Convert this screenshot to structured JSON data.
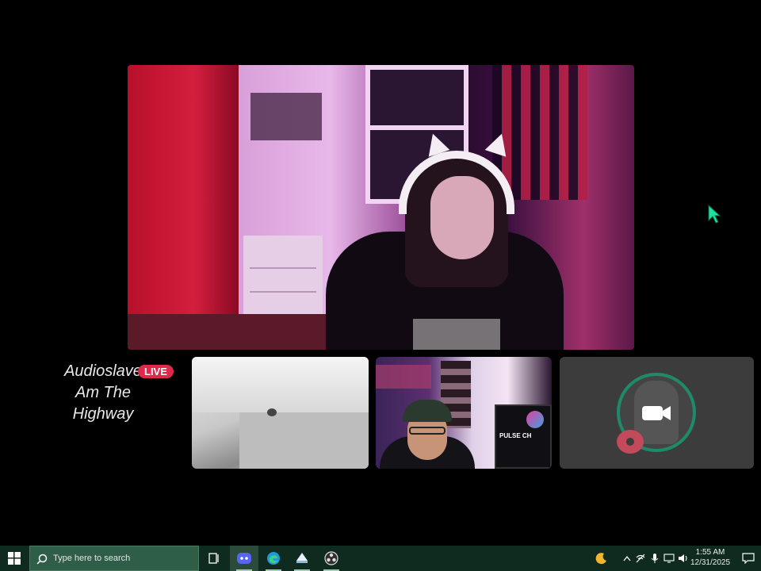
{
  "now_playing": {
    "artist": "Audioslave",
    "title_line1": "Am The",
    "title_line2": "Highway",
    "live_badge": "LIVE"
  },
  "participants": [
    {
      "id": "main-streamer",
      "role": "main camera"
    },
    {
      "id": "guest-1",
      "role": "camera tile"
    },
    {
      "id": "guest-2",
      "role": "camera tile",
      "monitor_text": "PULSE CH"
    },
    {
      "id": "guest-3",
      "role": "camera off tile",
      "icon": "video-camera-icon"
    }
  ],
  "taskbar": {
    "search_placeholder": "Type here to search",
    "apps": [
      {
        "name": "task-view",
        "icon": "task-view-icon"
      },
      {
        "name": "discord",
        "icon": "discord-icon",
        "active": true
      },
      {
        "name": "edge",
        "icon": "edge-icon",
        "running": true
      },
      {
        "name": "steam",
        "icon": "steam-icon",
        "running": true
      },
      {
        "name": "obs",
        "icon": "obs-icon",
        "running": true
      }
    ],
    "tray": {
      "icons": [
        "moon-icon",
        "chevron-up-icon",
        "network-icon",
        "microphone-icon",
        "display-icon",
        "wifi-icon",
        "volume-icon"
      ],
      "time": "1:55 AM",
      "date": "12/31/2025"
    }
  },
  "colors": {
    "taskbar_bg": "#0f2a1e",
    "search_bg": "#2f5e48",
    "live_badge": "#e0294a",
    "cursor": "#1fe0a0",
    "avatar_ring": "#1e8a6a"
  }
}
